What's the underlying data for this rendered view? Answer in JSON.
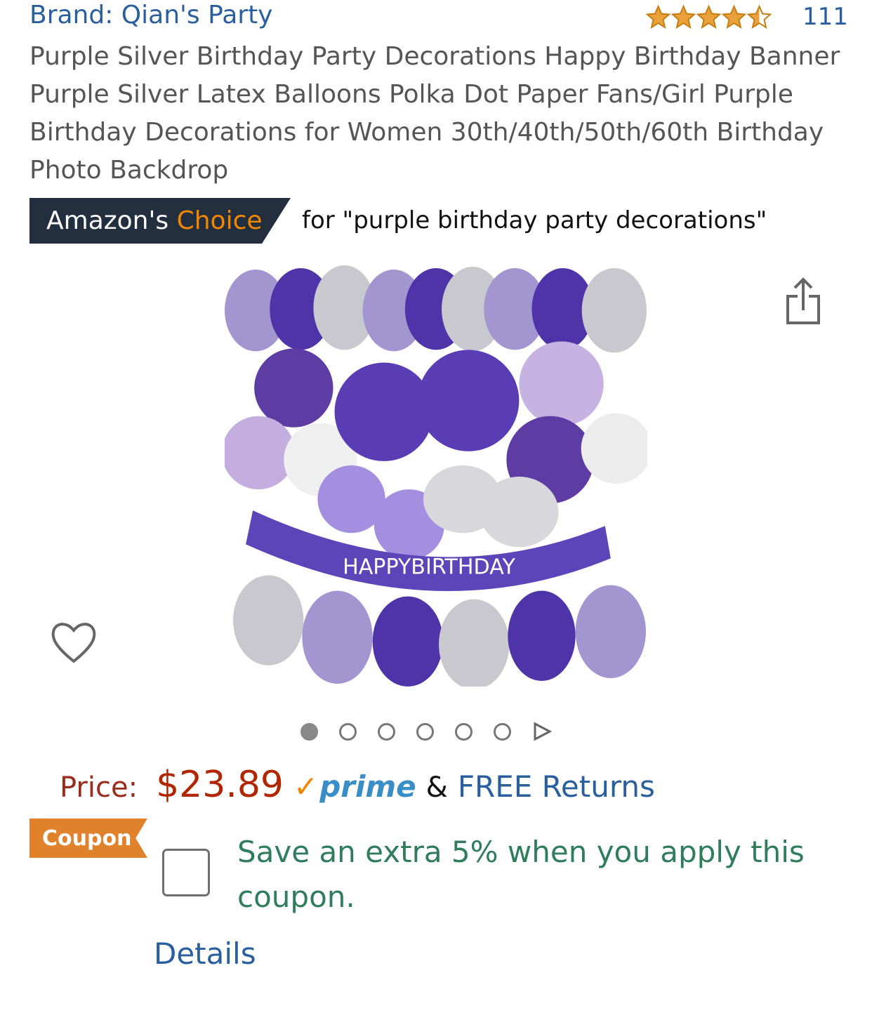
{
  "brand": {
    "label": "Brand: Qian's Party"
  },
  "rating": {
    "stars": 4.5,
    "max_stars": 5,
    "count": "111"
  },
  "product": {
    "title": "Purple Silver Birthday Party Decorations Happy Birthday Banner Purple Silver Latex Balloons Polka Dot Paper Fans/Girl Purple Birthday Decorations for Women 30th/40th/50th/60th Birthday Photo Backdrop"
  },
  "choice": {
    "prefix": "Amazon's ",
    "highlight": "Choice",
    "for_text": "for \"purple birthday party decorations\""
  },
  "image": {
    "banner_letters": "HAPPYBIRTHDAY",
    "colors": {
      "dark_purple": "#4e34a8",
      "light_purple": "#a395cf",
      "silver": "#c8c8ce"
    }
  },
  "carousel": {
    "total": 6,
    "active": 1
  },
  "price": {
    "label": "Price:",
    "value": "$23.89",
    "prime_check": "✓",
    "prime": "prime",
    "amp": "&",
    "free_returns": "FREE Returns"
  },
  "coupon": {
    "badge": "Coupon",
    "text": "Save an extra 5% when you apply this coupon.",
    "details": "Details"
  },
  "colors": {
    "link": "#2a5f9e",
    "price": "#b12704",
    "star": "#e9a23b",
    "coupon_badge": "#e0822c",
    "coupon_text": "#2f7d5d",
    "badge_dark": "#232f3e"
  },
  "icons": [
    "share-icon",
    "heart-icon",
    "next-arrow-icon",
    "star-icon"
  ]
}
